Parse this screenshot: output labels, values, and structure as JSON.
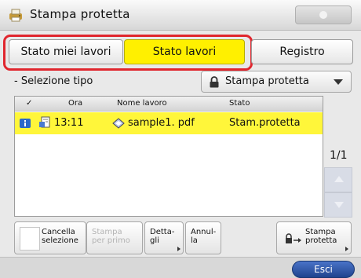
{
  "window": {
    "title": "Stampa protetta"
  },
  "tabs": [
    {
      "label": "Stato miei lavori"
    },
    {
      "label": "Stato lavori",
      "selected": true
    },
    {
      "label": "Registro"
    }
  ],
  "filter": {
    "label": "- Selezione tipo",
    "selected": "Stampa protetta"
  },
  "table": {
    "headers": {
      "check": "✓",
      "time": "Ora",
      "name": "Nome lavoro",
      "state": "Stato"
    },
    "rows": [
      {
        "time": "13:11",
        "name": "sample1. pdf",
        "state": "Stam.protetta",
        "selected": true
      }
    ]
  },
  "paging": {
    "counter": "1/1"
  },
  "buttons": {
    "cancel_selection": "Cancella\nselezione",
    "print_first": "Stampa\nper primo",
    "details": "Detta-\ngli",
    "cancel": "Annul-\nla",
    "secure_print": "Stampa\nprotetta",
    "exit": "Esci"
  },
  "colors": {
    "selected_tab": "#fff000",
    "selected_row": "#fff63a",
    "highlight_outline": "#e0262e",
    "exit_button": "#2b55a8"
  },
  "icons": [
    "printer-app-icon",
    "lock-icon",
    "info-status-icon",
    "document-icon",
    "pdf-file-icon",
    "secure-print-icon"
  ]
}
